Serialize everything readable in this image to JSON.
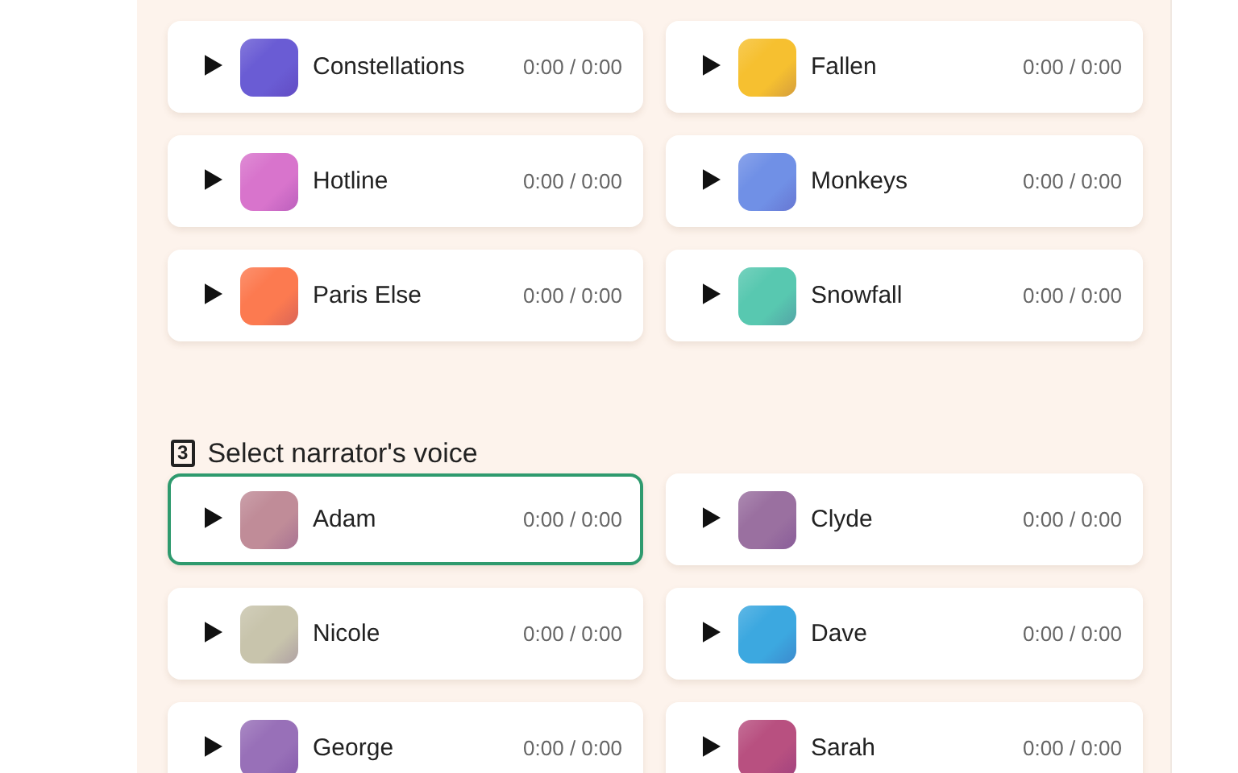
{
  "tracks": [
    {
      "name": "Constellations",
      "time": "0:00 / 0:00",
      "color": "#6a5cd4"
    },
    {
      "name": "Fallen",
      "time": "0:00 / 0:00",
      "color": "#f6c030"
    },
    {
      "name": "Hotline",
      "time": "0:00 / 0:00",
      "color": "#d874cc"
    },
    {
      "name": "Monkeys",
      "time": "0:00 / 0:00",
      "color": "#7090e6"
    },
    {
      "name": "Paris Else",
      "time": "0:00 / 0:00",
      "color": "#fc7a50"
    },
    {
      "name": "Snowfall",
      "time": "0:00 / 0:00",
      "color": "#58c8b0"
    }
  ],
  "voice_section": {
    "step": "3",
    "title": "Select narrator's voice"
  },
  "voices": [
    {
      "name": "Adam",
      "time": "0:00 / 0:00",
      "color": "#c08c98",
      "selected": true
    },
    {
      "name": "Clyde",
      "time": "0:00 / 0:00",
      "color": "#9a70a0",
      "selected": false
    },
    {
      "name": "Nicole",
      "time": "0:00 / 0:00",
      "color": "#c8c4ac",
      "selected": false
    },
    {
      "name": "Dave",
      "time": "0:00 / 0:00",
      "color": "#3ca8e0",
      "selected": false
    },
    {
      "name": "George",
      "time": "0:00 / 0:00",
      "color": "#9870b8",
      "selected": false
    },
    {
      "name": "Sarah",
      "time": "0:00 / 0:00",
      "color": "#b85080",
      "selected": false
    }
  ]
}
